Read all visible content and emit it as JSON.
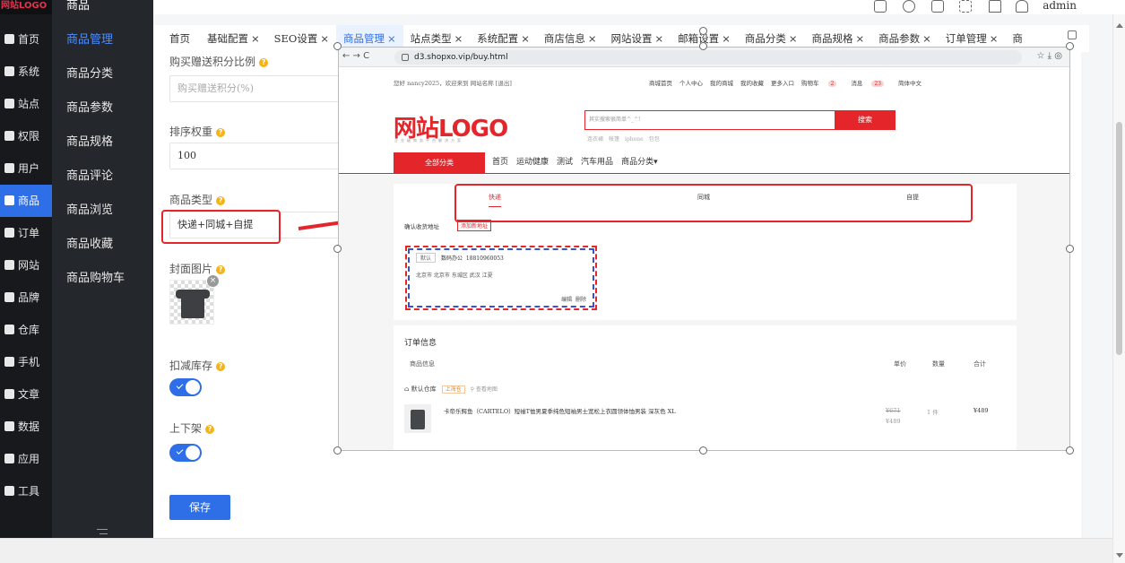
{
  "brand": "网站LOGO",
  "rail": [
    {
      "icon": "home-icon",
      "label": "首页"
    },
    {
      "icon": "gear-icon",
      "label": "系统"
    },
    {
      "icon": "sliders-icon",
      "label": "站点"
    },
    {
      "icon": "lock-icon",
      "label": "权限"
    },
    {
      "icon": "user-icon",
      "label": "用户"
    },
    {
      "icon": "goods-icon",
      "label": "商品",
      "active": true
    },
    {
      "icon": "order-icon",
      "label": "订单"
    },
    {
      "icon": "store-icon",
      "label": "网站"
    },
    {
      "icon": "brand-icon",
      "label": "品牌"
    },
    {
      "icon": "warehouse-icon",
      "label": "仓库"
    },
    {
      "icon": "phone-icon",
      "label": "手机"
    },
    {
      "icon": "article-icon",
      "label": "文章"
    },
    {
      "icon": "chart-icon",
      "label": "数据"
    },
    {
      "icon": "apps-icon",
      "label": "应用"
    },
    {
      "icon": "wrench-icon",
      "label": "工具"
    }
  ],
  "submenu": {
    "header": "商品",
    "items": [
      "商品管理",
      "商品分类",
      "商品参数",
      "商品规格",
      "商品评论",
      "商品浏览",
      "商品收藏",
      "商品购物车"
    ]
  },
  "topbar": {
    "user": "admin"
  },
  "tabs": [
    {
      "label": "首页",
      "close": ""
    },
    {
      "label": "基础配置",
      "close": "×"
    },
    {
      "label": "SEO设置",
      "close": "×"
    },
    {
      "label": "商品管理",
      "close": "×",
      "active": true
    },
    {
      "label": "站点类型",
      "close": "×"
    },
    {
      "label": "系统配置",
      "close": "×"
    },
    {
      "label": "商店信息",
      "close": "×"
    },
    {
      "label": "网站设置",
      "close": "×"
    },
    {
      "label": "邮箱设置",
      "close": "×"
    },
    {
      "label": "商品分类",
      "close": "×"
    },
    {
      "label": "商品规格",
      "close": "×"
    },
    {
      "label": "商品参数",
      "close": "×"
    },
    {
      "label": "订单管理",
      "close": "×"
    },
    {
      "label": "商",
      "close": ""
    }
  ],
  "form": {
    "points_label": "购买赠送积分比例",
    "points_placeholder": "购买赠送积分(%)",
    "sort_label": "排序权重",
    "sort_value": "100",
    "type_label": "商品类型",
    "type_value": "快递+同城+自提",
    "cover_label": "封面图片",
    "deduct_label": "扣减库存",
    "deduct_on": true,
    "shelf_label": "上下架",
    "shelf_on": true,
    "save": "保存"
  },
  "shot": {
    "url": "d3.shopxo.vip/buy.html",
    "welcome": "您好 nancy2025，欢迎来到 网站名称 [退出]",
    "topmenu": [
      "商城首页",
      "个人中心",
      "我的商城",
      "我的收藏",
      "更多入口",
      "购物车"
    ],
    "cart_count": "2",
    "msg_label": "消息",
    "msg_count": "23",
    "lang": "简体中文",
    "logo": "网站LOGO",
    "slogan": "企业级商务平台解决方案",
    "search_placeholder": "其实搜索很简单^_^!",
    "search_btn": "搜索",
    "hot": [
      "连衣裙",
      "帐篷",
      "iphone",
      "包包"
    ],
    "all_cat": "全部分类",
    "catnav": [
      "首页",
      "运动健康",
      "测试",
      "汽车用品",
      "商品分类▾"
    ],
    "delivery": [
      "快递",
      "同城",
      "自提"
    ],
    "addr_title": "确认收货地址",
    "add_addr": "添加新地址",
    "addr_tag": "默认",
    "addr_name": "数码办公",
    "addr_phone": "18810960053",
    "addr_text": "北京市 北京市 东城区 武汉 江夏",
    "edit": "编辑",
    "del": "删除",
    "order_title": "订单信息",
    "cols": [
      "商品信息",
      "单价",
      "数量",
      "合计"
    ],
    "warehouse": "默认仓库",
    "wh_tag": "上海仓",
    "map": "查看地图",
    "product": "卡帝乐鳄鱼（CARTELO）短袖T恤男夏季纯色短袖男士宽松上衣圆领体恤男装 深灰色 XL",
    "price_old": "¥671",
    "price_new": "¥489",
    "qty": "1 件",
    "total": "¥489"
  },
  "colors": {
    "accent": "#2e6ee6",
    "red": "#e4262b",
    "rail": "#17191c"
  }
}
